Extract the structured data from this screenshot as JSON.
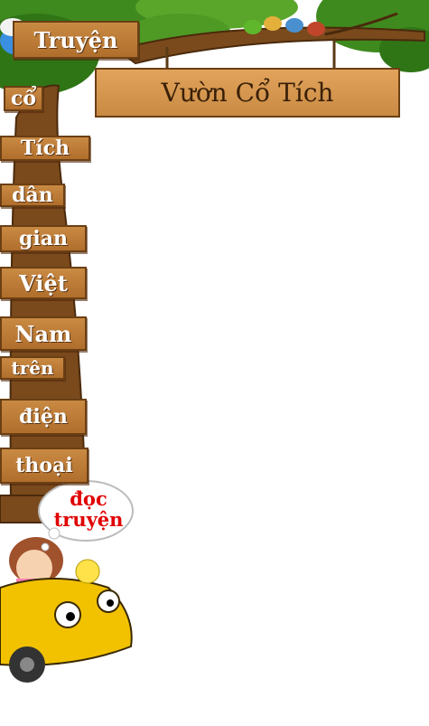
{
  "title_sign": "Vườn Cổ Tích",
  "nav_signs": [
    "Truyện",
    "cổ",
    "Tích",
    "dân",
    "gian",
    "Việt",
    "Nam",
    "trên",
    "điện",
    "thoại"
  ],
  "cloud": {
    "line1": "đọc",
    "line2": "truyện"
  },
  "colors": {
    "wood": "#c98a43",
    "leaf": "#3f8a1e",
    "trunk": "#7a4a1c",
    "car": "#f2c200",
    "cloud_text": "#e00000"
  },
  "icons": [
    "smurf-icon",
    "bird-icon",
    "girl-icon",
    "chick-icon",
    "car-icon"
  ]
}
